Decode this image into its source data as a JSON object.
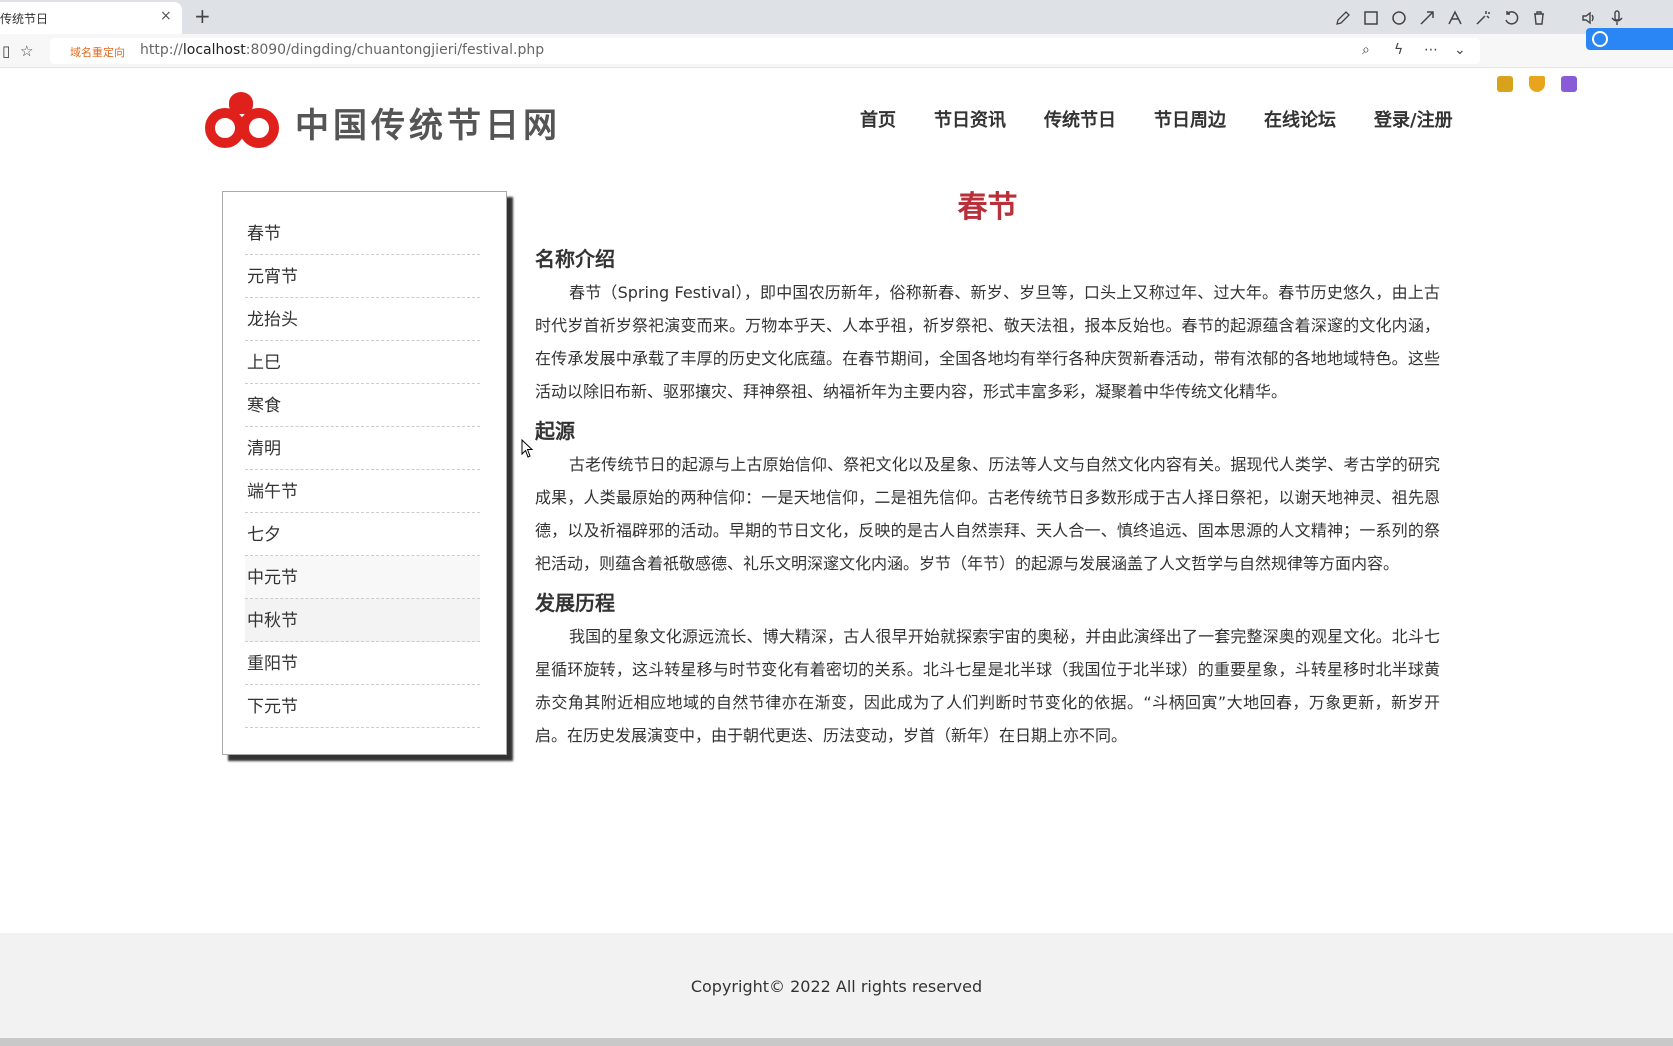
{
  "browser": {
    "tab_title": "传统节日",
    "tab_close": "×",
    "new_tab": "+",
    "redirect_label": "域名重定向",
    "url_prefix": "http://",
    "url_host": "localhost",
    "url_rest": ":8090/dingding/chuantongjieri/festival.php"
  },
  "site": {
    "logo_text": "中国传统节日网",
    "nav": [
      "首页",
      "节日资讯",
      "传统节日",
      "节日周边",
      "在线论坛",
      "登录/注册"
    ]
  },
  "sidebar": {
    "items": [
      "春节",
      "元宵节",
      "龙抬头",
      "上巳",
      "寒食",
      "清明",
      "端午节",
      "七夕",
      "中元节",
      "中秋节",
      "重阳节",
      "下元节"
    ]
  },
  "content": {
    "title": "春节",
    "sections": [
      {
        "heading": "名称介绍",
        "body": "春节（Spring Festival），即中国农历新年，俗称新春、新岁、岁旦等，口头上又称过年、过大年。春节历史悠久，由上古时代岁首祈岁祭祀演变而来。万物本乎天、人本乎祖，祈岁祭祀、敬天法祖，报本反始也。春节的起源蕴含着深邃的文化内涵，在传承发展中承载了丰厚的历史文化底蕴。在春节期间，全国各地均有举行各种庆贺新春活动，带有浓郁的各地地域特色。这些活动以除旧布新、驱邪攘灾、拜神祭祖、纳福祈年为主要内容，形式丰富多彩，凝聚着中华传统文化精华。"
      },
      {
        "heading": "起源",
        "body": "古老传统节日的起源与上古原始信仰、祭祀文化以及星象、历法等人文与自然文化内容有关。据现代人类学、考古学的研究成果，人类最原始的两种信仰：一是天地信仰，二是祖先信仰。古老传统节日多数形成于古人择日祭祀，以谢天地神灵、祖先恩德，以及祈福辟邪的活动。早期的节日文化，反映的是古人自然崇拜、天人合一、慎终追远、固本思源的人文精神；一系列的祭祀活动，则蕴含着祇敬感德、礼乐文明深邃文化内涵。岁节（年节）的起源与发展涵盖了人文哲学与自然规律等方面内容。"
      },
      {
        "heading": "发展历程",
        "body": "我国的星象文化源远流长、博大精深，古人很早开始就探索宇宙的奥秘，并由此演绎出了一套完整深奥的观星文化。北斗七星循环旋转，这斗转星移与时节变化有着密切的关系。北斗七星是北半球（我国位于北半球）的重要星象，斗转星移时北半球黄赤交角其附近相应地域的自然节律亦在渐变，因此成为了人们判断时节变化的依据。“斗柄回寅”大地回春，万象更新，新岁开启。在历史发展演变中，由于朝代更迭、历法变动，岁首（新年）在日期上亦不同。"
      }
    ]
  },
  "footer": {
    "copyright": "Copyright© 2022 All rights reserved"
  },
  "colors": {
    "accent_red": "#e0201b",
    "title_red": "#b8303a"
  }
}
